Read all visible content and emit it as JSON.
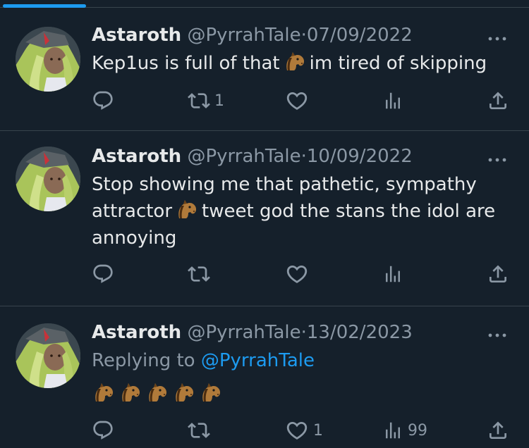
{
  "tweets": [
    {
      "name": "Astaroth",
      "handle": "@PyrrahTale",
      "date": "07/09/2022",
      "lines": [
        "Kep1us is full of that",
        "im tired of skipping"
      ],
      "retweets": "1",
      "likes": "",
      "views": ""
    },
    {
      "name": "Astaroth",
      "handle": "@PyrrahTale",
      "date": "10/09/2022",
      "lines": [
        "Stop showing me that pathetic, sympathy",
        "attractor",
        "tweet god the stans the idol are",
        "annoying"
      ],
      "retweets": "",
      "likes": "",
      "views": ""
    },
    {
      "name": "Astaroth",
      "handle": "@PyrrahTale",
      "date": "13/02/2023",
      "replying_prefix": "Replying to",
      "replying_to": "@PyrrahTale",
      "horse_count": 5,
      "retweets": "",
      "likes": "1",
      "views": "99"
    }
  ],
  "separator": "·",
  "icons": {
    "reply": "reply-icon",
    "retweet": "retweet-icon",
    "like": "heart-icon",
    "views": "views-icon",
    "share": "share-icon",
    "more": "more-icon",
    "emoji": "horse-face-emoji"
  },
  "colors": {
    "background": "#15202b",
    "text": "#e7e9ea",
    "muted": "#8b98a5",
    "accent": "#1d9bf0",
    "divider": "#38444d"
  }
}
